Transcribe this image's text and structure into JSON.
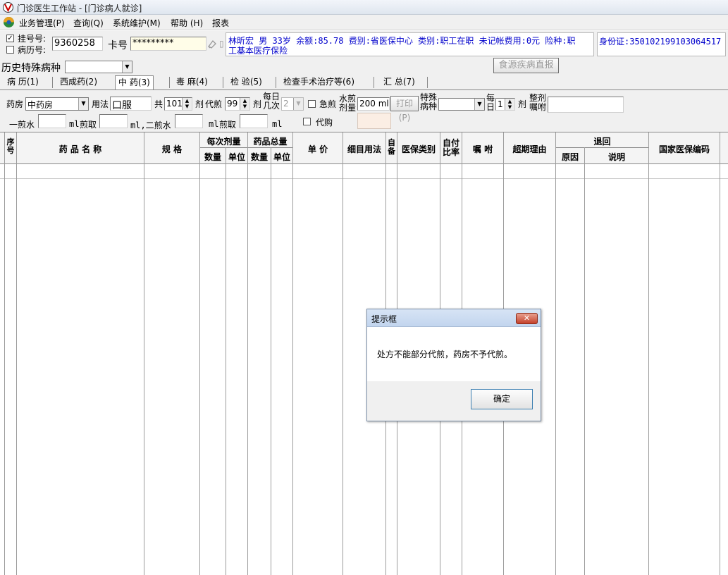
{
  "window": {
    "title": "门诊医生工作站 - [门诊病人就诊]"
  },
  "menu": [
    "业务管理(P)",
    "查询(Q)",
    "系统维护(M)",
    "帮助 (H)",
    "报表"
  ],
  "patient": {
    "reg_label": "挂号号:",
    "record_label": "病历号:",
    "reg_checked": "✓",
    "reg_no": "9360258",
    "card_label": "卡号",
    "card_no": "*********",
    "info_line1": "林昕宏  男  33岁  余额:85.78  费别:省医保中心  类别:职工在职  未记帐费用:0元  险种:职",
    "info_line2": "工基本医疗保险",
    "id_card": "身份证:350102199103064517"
  },
  "history": {
    "label": "历史特殊病种",
    "value": ""
  },
  "food_button": "食源疾病直报",
  "tabs": [
    "病 历(1)",
    "西成药(2)",
    "中 药(3)",
    "毒 麻(4)",
    "检 验(5)",
    "检查手术治疗等(6)",
    "汇 总(7)"
  ],
  "rx": {
    "pharmacy_label": "药房",
    "pharmacy_value": "中药房",
    "usage_label": "用法",
    "usage_value": "口服",
    "total_label": "共",
    "total_value": "101",
    "unit_ji": "剂",
    "decoction_label": "代煎",
    "decoction_value": "99",
    "daily_times_label_1": "每日",
    "daily_times_label_2": "几次",
    "daily_times_value": "2",
    "urgent_label": "急煎",
    "water_label_1": "水煎",
    "water_label_2": "剂量",
    "water_value": "200",
    "water_unit": "ml",
    "print_button": "打印(P)",
    "special_label_1": "特殊",
    "special_label_2": "病种",
    "special_value": "",
    "daily_label_1": "每",
    "daily_label_2": "日",
    "daily_value": "1",
    "whole_label_1": "整剂",
    "whole_label_2": "嘱咐",
    "whole_value": "",
    "first_water_label": "一煎水",
    "ml": "ml",
    "decoct_take_label": "煎取",
    "second_water_label": "ml,二煎水",
    "proxy_label": "代购"
  },
  "grid": {
    "headers": {
      "seq": "序号",
      "name": "药 品 名 称",
      "spec": "规 格",
      "per_dose": "每次剂量",
      "per_qty": "数量",
      "per_unit": "单位",
      "total": "药品总量",
      "total_qty": "数量",
      "total_unit": "单位",
      "price": "单 价",
      "detail_usage": "细目用法",
      "self_prep": "自备",
      "insurance_type": "医保类别",
      "self_pay": "自付比率",
      "instruction": "嘱 咐",
      "overdue": "超期理由",
      "return": "退回",
      "return_reason": "原因",
      "return_note": "说明",
      "national_code": "国家医保编码"
    }
  },
  "dialog": {
    "title": "提示框",
    "message": "处方不能部分代煎，药房不予代煎。",
    "ok": "确定"
  }
}
